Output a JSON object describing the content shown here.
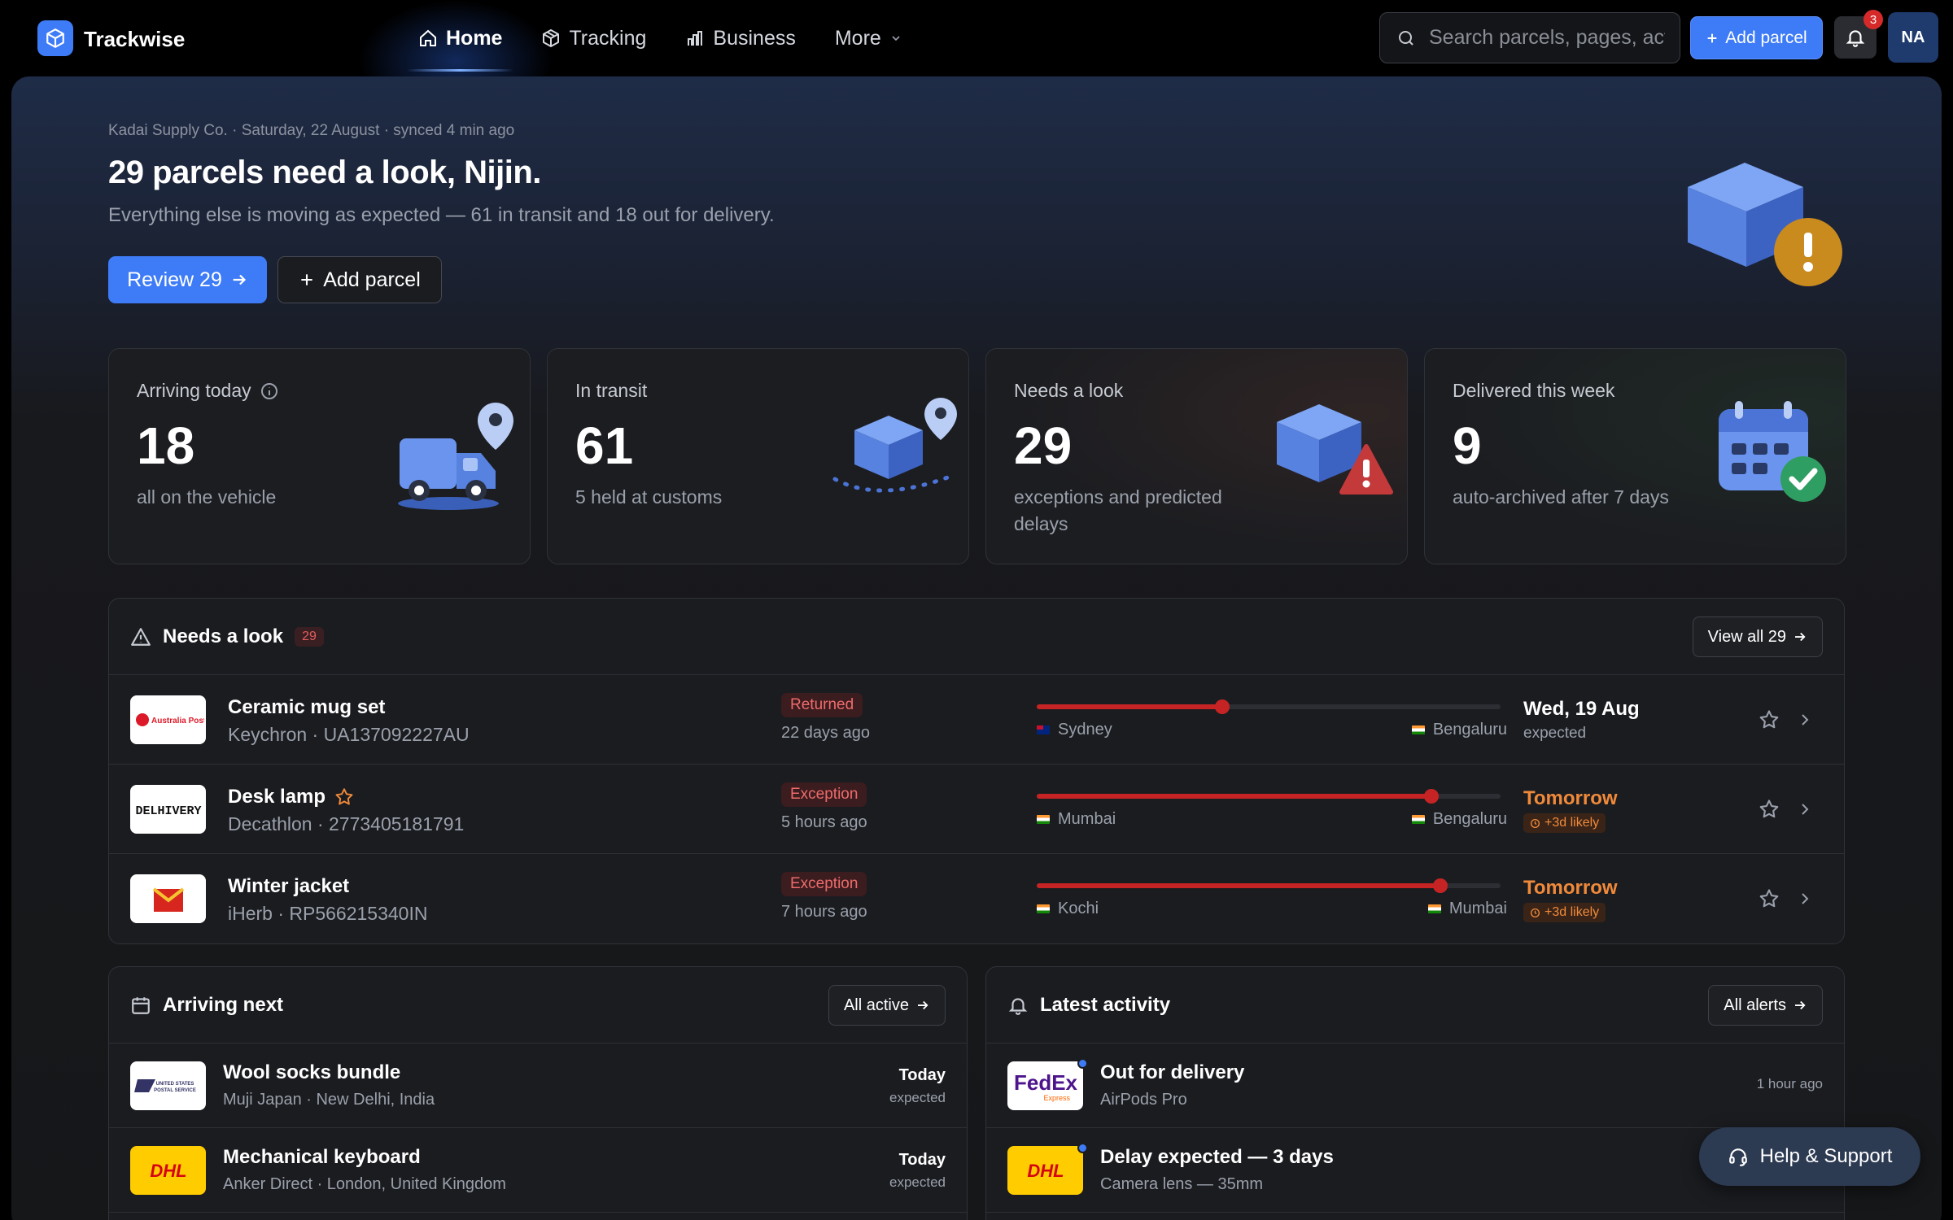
{
  "app": {
    "brand": "Trackwise"
  },
  "nav": [
    {
      "label": "Home",
      "icon": "home-icon",
      "active": true
    },
    {
      "label": "Tracking",
      "icon": "package-icon"
    },
    {
      "label": "Business",
      "icon": "bar-chart-icon"
    },
    {
      "label": "More",
      "icon": "chevron-down-icon"
    }
  ],
  "search": {
    "placeholder": "Search parcels, pages, actions"
  },
  "topbar": {
    "add_label": "Add parcel",
    "notifications_count": "3",
    "avatar_initials": "NA"
  },
  "hero": {
    "meta": "Kadai Supply Co. · Saturday, 22 August · synced 4 min ago",
    "title": "29 parcels need a look, Nijin.",
    "subtitle": "Everything else is moving as expected — 61 in transit and 18 out for delivery.",
    "review_label": "Review 29",
    "add_label": "Add parcel"
  },
  "stats": [
    {
      "label": "Arriving today",
      "value": "18",
      "desc": "all on the vehicle",
      "icon": "truck-icon"
    },
    {
      "label": "In transit",
      "value": "61",
      "desc": "5 held at customs",
      "icon": "box-route-icon"
    },
    {
      "label": "Needs a look",
      "value": "29",
      "desc": "exceptions and predicted delays",
      "icon": "box-warning-icon"
    },
    {
      "label": "Delivered this week",
      "value": "9",
      "desc": "auto-archived after 7 days",
      "icon": "calendar-check-icon"
    }
  ],
  "needs_look": {
    "title": "Needs a look",
    "count": "29",
    "view_all_label": "View all 29",
    "rows": [
      {
        "carrier": "Australia Post",
        "name": "Ceramic mug set",
        "sub": "Keychron · UA137092227AU",
        "status": "Returned",
        "age": "22 days ago",
        "from": "Sydney",
        "to": "Bengaluru",
        "progress": 0.4,
        "eta": "Wed, 19 Aug",
        "eta_sub": "expected",
        "late": false
      },
      {
        "carrier": "DELHIVERY",
        "name": "Desk lamp",
        "sub": "Decathlon · 2773405181791",
        "status": "Exception",
        "age": "5 hours ago",
        "from": "Mumbai",
        "to": "Bengaluru",
        "progress": 0.85,
        "eta": "Tomorrow",
        "eta_sub": "+3d likely",
        "late": true
      },
      {
        "carrier": "India Post",
        "name": "Winter jacket",
        "sub": "iHerb · RP566215340IN",
        "status": "Exception",
        "age": "7 hours ago",
        "from": "Kochi",
        "to": "Mumbai",
        "progress": 0.87,
        "eta": "Tomorrow",
        "eta_sub": "+3d likely",
        "late": true
      }
    ]
  },
  "arriving_next": {
    "title": "Arriving next",
    "button_label": "All active",
    "rows": [
      {
        "carrier": "UNITED STATES POSTAL SERVICE",
        "name": "Wool socks bundle",
        "sub": "Muji Japan · New Delhi, India",
        "when": "Today",
        "when_sub": "expected"
      },
      {
        "carrier": "DHL",
        "name": "Mechanical keyboard",
        "sub": "Anker Direct · London, United Kingdom",
        "when": "Today",
        "when_sub": "expected"
      }
    ]
  },
  "latest_activity": {
    "title": "Latest activity",
    "button_label": "All alerts",
    "rows": [
      {
        "carrier": "FedEx",
        "carrier_sub": "Express",
        "title": "Out for delivery",
        "sub": "AirPods Pro",
        "time": "1 hour ago"
      },
      {
        "carrier": "DHL",
        "title": "Delay expected — 3 days",
        "sub": "Camera lens — 35mm",
        "time": ""
      }
    ]
  },
  "help": {
    "label": "Help & Support"
  },
  "colors": {
    "accent": "#3e7bf7",
    "danger": "#c62424",
    "warning": "#f08a3a",
    "background": "#161719"
  }
}
